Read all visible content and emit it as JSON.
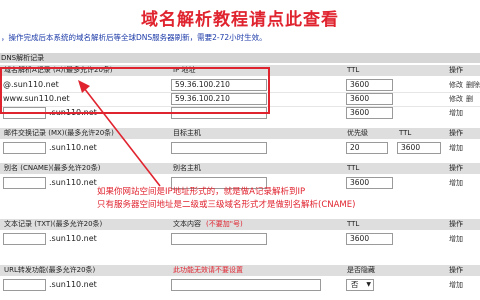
{
  "page": {
    "banner_title": "域名解析教程请点此查看",
    "notice": "，操作完成后本系统的域名解析后等全球DNS服务器刷新，需要2-72小时生效。"
  },
  "dns": {
    "section_title": "DNS解析记录",
    "a_record": {
      "headers": {
        "host": "域名解析A记录 (A)(最多允许20条)",
        "ip": "IP 地址",
        "ttl": "TTL",
        "op": "操作"
      },
      "rows": [
        {
          "host": "@.sun110.net",
          "ip": "59.36.100.210",
          "ttl": "3600",
          "actions": [
            "修改",
            "删除"
          ]
        },
        {
          "host": "www.sun110.net",
          "ip": "59.36.100.210",
          "ttl": "3600",
          "actions": [
            "修改",
            "删"
          ]
        },
        {
          "host": ".sun110.net",
          "ip": "",
          "ttl": "3600",
          "actions": [
            "增加"
          ]
        }
      ]
    },
    "mx_record": {
      "headers": {
        "host": "邮件交换记录 (MX)(最多允许20条)",
        "target": "目标主机",
        "priority": "优先级",
        "ttl": "TTL",
        "op": "操作"
      },
      "row": {
        "host": ".sun110.net",
        "target": "",
        "priority": "20",
        "ttl": "3600",
        "action": "增加"
      }
    },
    "cname_record": {
      "headers": {
        "host": "别名 (CNAME)(最多允许20条)",
        "alias": "别名主机",
        "ttl": "TTL",
        "op": "操作"
      },
      "row": {
        "host": ".sun110.net",
        "alias": "",
        "ttl": "3600",
        "action": "增加"
      }
    },
    "txt_record": {
      "headers": {
        "host": "文本记录 (TXT)(最多允许20条)",
        "content": "文本内容",
        "content_note": "(不要加\"号)",
        "ttl": "TTL",
        "op": "操作"
      },
      "row": {
        "host": ".sun110.net",
        "content": "",
        "ttl": "3600",
        "action": "增加"
      }
    },
    "url_forward": {
      "headers": {
        "host": "URL转发功能(最多允许20条)",
        "note": "此功能无效请不要设置",
        "hidden": "是否隐藏",
        "op": "操作"
      },
      "row": {
        "host": ".sun110.net",
        "target": "",
        "hidden": "否",
        "action": "增加"
      }
    }
  },
  "annotation": {
    "line1": "如果你网站空间是IP地址形式的，就是做A记录解析到IP",
    "line2": "只有服务器空间地址是二级或三级域名形式才是做别名解析(CNAME)"
  },
  "colors": {
    "accent_red": "#e0242f",
    "notice_blue": "#1c3aa8",
    "header_gray": "#d6d6d6"
  }
}
